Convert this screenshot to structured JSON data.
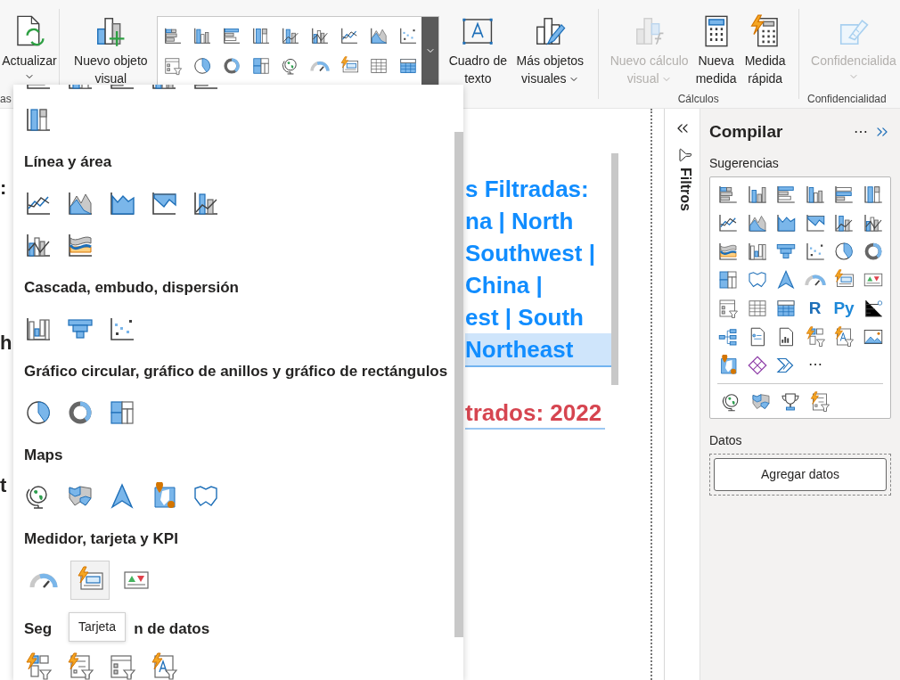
{
  "ribbon": {
    "refresh": {
      "label": "Actualizar"
    },
    "first_group_label": "as",
    "new_visual": {
      "label": "Nuevo objeto visual"
    },
    "text_box": {
      "label": "Cuadro de texto"
    },
    "more_visuals": {
      "label": "Más objetos visuales"
    },
    "visual_calculation": {
      "label": "Nuevo cálculo visual",
      "disabled": true
    },
    "new_measure": {
      "label": "Nueva medida",
      "disabled": false
    },
    "quick_measure": {
      "label": "Medida rápida",
      "disabled": false
    },
    "calculations_group_label": "Cálculos",
    "sensitivity": {
      "label": "Confidencialida",
      "disabled": true
    },
    "sensitivity_group_label": "Confidencialidad"
  },
  "canvas": {
    "left_fragments": [
      ":",
      "h",
      "t"
    ],
    "title_lines": [
      {
        "text": "s Filtradas:",
        "selected": false
      },
      {
        "text": "na | North",
        "selected": false
      },
      {
        "text": "Southwest |",
        "selected": false
      },
      {
        "text": "China |",
        "selected": false
      },
      {
        "text": "est | South",
        "selected": false
      },
      {
        "text": "Northeast",
        "selected": true
      }
    ],
    "year_line": "trados: 2022"
  },
  "visuals_menu": {
    "sections": [
      {
        "heading": "Línea y área"
      },
      {
        "heading": "Cascada, embudo, dispersión"
      },
      {
        "heading": "Gráfico circular, gráfico de anillos y gráfico de rectángulos"
      },
      {
        "heading": "Maps"
      },
      {
        "heading": "Medidor, tarjeta y KPI",
        "items": [
          {
            "hovered": false
          },
          {
            "hovered": true
          },
          {
            "hovered": false
          }
        ]
      }
    ],
    "last_heading_parts": [
      "Seg",
      "n de datos"
    ],
    "tooltip": "Tarjeta"
  },
  "filters_pane": {
    "label": "Filtros"
  },
  "build_pane": {
    "title": "Compilar",
    "more_options": "⋯",
    "suggestions_label": "Sugerencias",
    "r_visual": "R",
    "python_visual": "Py",
    "more_visuals": "⋯",
    "data_label": "Datos",
    "add_data_button": "Agregar datos"
  }
}
